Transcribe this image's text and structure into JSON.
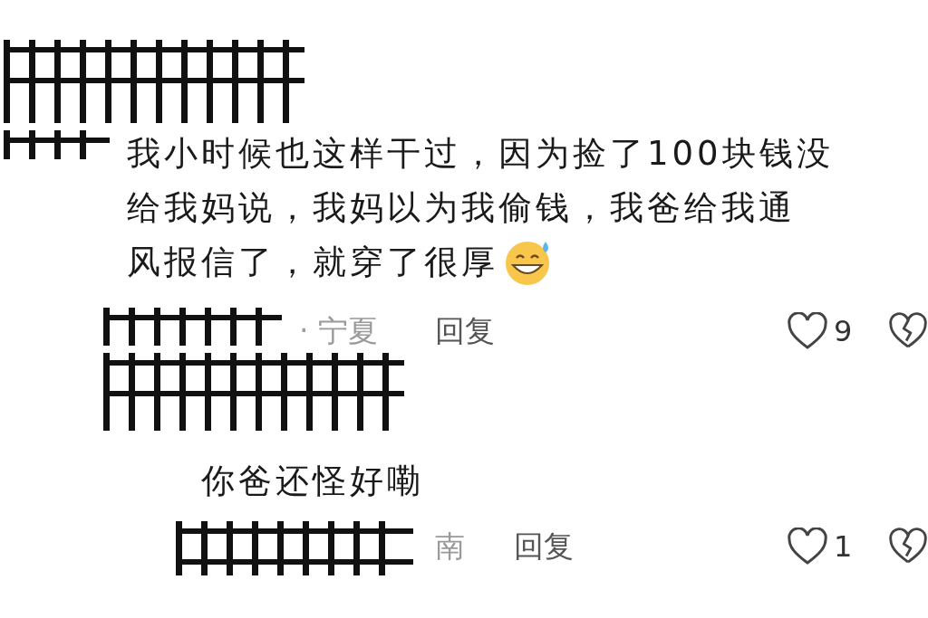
{
  "comment": {
    "lines": [
      "我小时候也这样干过，因为捡了100块钱没",
      "给我妈说，我妈以为我偷钱，我爸给我通",
      "风报信了，就穿了很厚"
    ],
    "meta": "· 宁夏",
    "reply_label": "回复",
    "likes": "9",
    "liked": false
  },
  "reply": {
    "text": "你爸还怪好嘞",
    "meta": "南",
    "reply_label": "回复",
    "likes": "1",
    "liked": false
  }
}
